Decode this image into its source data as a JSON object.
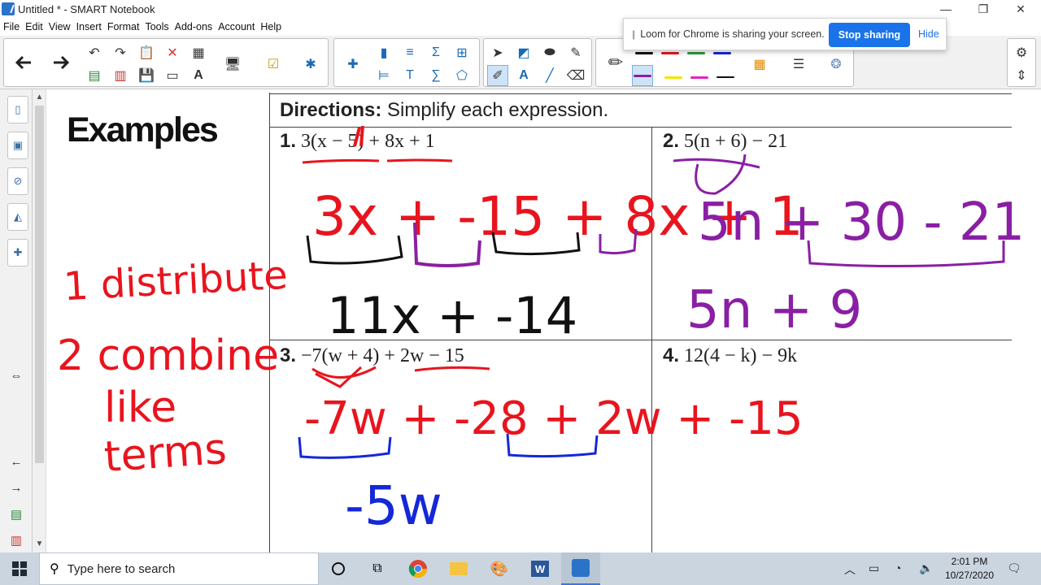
{
  "window": {
    "title": "Untitled * - SMART Notebook",
    "minimize": "—",
    "maximize": "❐",
    "close": "✕"
  },
  "menu": [
    "File",
    "Edit",
    "View",
    "Insert",
    "Format",
    "Tools",
    "Add-ons",
    "Account",
    "Help"
  ],
  "loom": {
    "message": "Loom for Chrome is sharing your screen.",
    "stop_label": "Stop sharing",
    "hide_label": "Hide"
  },
  "worksheet": {
    "directions_label": "Directions:",
    "directions_text": " Simplify each expression.",
    "examples_title": "Examples",
    "problems": [
      {
        "num": "1.",
        "expr": "3(x − 5) + 8x + 1"
      },
      {
        "num": "2.",
        "expr": "5(n + 6) − 21"
      },
      {
        "num": "3.",
        "expr": "−7(w + 4) + 2w − 15"
      },
      {
        "num": "4.",
        "expr": "12(4 − k) − 9k"
      }
    ]
  },
  "handwriting": {
    "steps": [
      "1 distribute",
      "2 combine",
      "like",
      "terms"
    ],
    "p1_work": "3x + -15 + 8x + 1",
    "p1_answer": "11x + -14",
    "p2_work": "5n + 30 - 21",
    "p2_answer": "5n + 9",
    "p3_work": "-7w + -28 + 2w + -15",
    "p3_answer": "-5w"
  },
  "colors": {
    "red_ink": "#e8141e",
    "purple_ink": "#8a1fa3",
    "blue_ink": "#1428d8",
    "black_ink": "#111111",
    "accent": "#1a73e8"
  },
  "taskbar": {
    "search_placeholder": "Type here to search",
    "time": "2:01 PM",
    "date": "10/27/2020"
  }
}
